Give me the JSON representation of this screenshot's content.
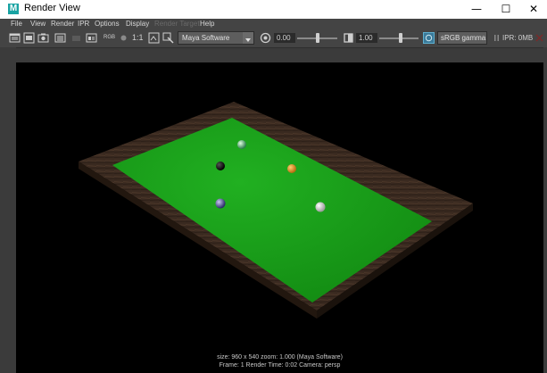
{
  "window": {
    "title": "Render View",
    "app_icon": "M",
    "controls": {
      "minimize": "—",
      "maximize": "☐",
      "close": "✕"
    }
  },
  "menu": [
    {
      "label": "File",
      "enabled": true
    },
    {
      "label": "View",
      "enabled": true
    },
    {
      "label": "Render",
      "enabled": true
    },
    {
      "label": "IPR",
      "enabled": true
    },
    {
      "label": "Options",
      "enabled": true
    },
    {
      "label": "Display",
      "enabled": true
    },
    {
      "label": "Render Target",
      "enabled": false
    },
    {
      "label": "Help",
      "enabled": true
    }
  ],
  "toolbar": {
    "rgb_label": "RGB",
    "ratio_label": "1:1",
    "renderer": "Maya Software",
    "exposure": "0.00",
    "gamma": "1.00",
    "color_space": "sRGB gamma",
    "ipr_label": "IPR: 0MB"
  },
  "status": {
    "line1": "size: 960 x 540  zoom: 1.000        (Maya Software)",
    "line2": "Frame: 1          Render Time: 0:02          Camera: persp"
  },
  "colors": {
    "felt": "#1aa21a",
    "rail": "#3a2a20",
    "background": "#000000"
  }
}
